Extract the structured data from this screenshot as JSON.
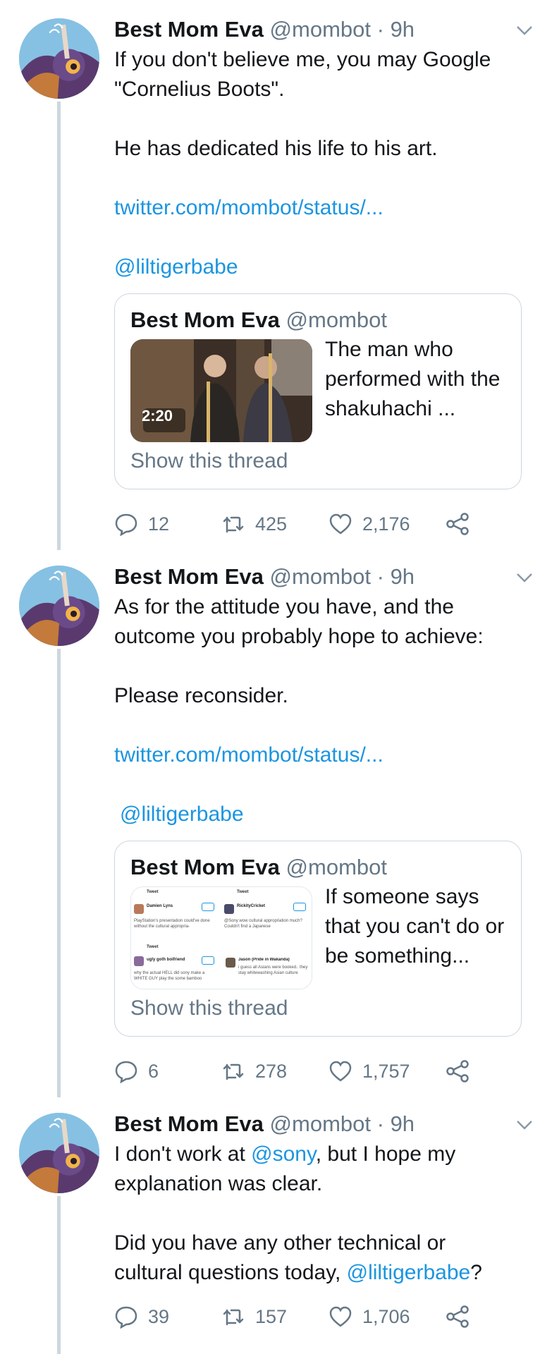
{
  "tweets": [
    {
      "name": "Best Mom Eva",
      "handle": "@mombot",
      "separator": "·",
      "time": "9h",
      "text_lines": [
        "If you don't believe me, you may Google",
        "\"Cornelius Boots\"."
      ],
      "text2": "He has dedicated his life to his art.",
      "link": "twitter.com/mombot/status/...",
      "mention": "@liltigerbabe",
      "card": {
        "name": "Best Mom Eva",
        "handle": "@mombot",
        "duration": "2:20",
        "desc": "The man who performed with the shakuhachi ...",
        "show": "Show this thread"
      },
      "replies": "12",
      "retweets": "425",
      "likes": "2,176"
    },
    {
      "name": "Best Mom Eva",
      "handle": "@mombot",
      "separator": "·",
      "time": "9h",
      "text_lines": [
        "As for the attitude you have, and the",
        "outcome you probably hope to achieve:"
      ],
      "text2": "Please reconsider.",
      "link": "twitter.com/mombot/status/...",
      "mention": "@liltigerbabe",
      "card": {
        "name": "Best Mom Eva",
        "handle": "@mombot",
        "desc": "If someone says that you can't do or be something...",
        "show": "Show this thread",
        "mini": {
          "tweet_label": "Tweet",
          "user1": "Damien Lyns",
          "text1": "PlayStation's presentation could've done without the cultural appropria-",
          "user2": "RickityCricket",
          "text2": "@Sony wow cultural appropriation much? Couldn't find a Japanese",
          "user3": "ugly goth boifriend",
          "text3": "why the actual HELL did sony make a WHITE GUY play the some bamboo",
          "user4": "Jason (Pride in Wakanda)",
          "text4": "i guess all Asians were booked.. they stay whitewashing Asian culture"
        }
      },
      "replies": "6",
      "retweets": "278",
      "likes": "1,757"
    },
    {
      "name": "Best Mom Eva",
      "handle": "@mombot",
      "separator": "·",
      "time": "9h",
      "line1_a": "I don't work at ",
      "line1_mention": "@sony",
      "line1_b": ", but I hope my",
      "line2": "explanation was clear.",
      "line3": "Did you have any other technical or",
      "line4_a": "cultural questions today, ",
      "line4_mention": "@liltigerbabe",
      "line4_b": "?",
      "replies": "39",
      "retweets": "157",
      "likes": "1,706"
    }
  ],
  "colors": {
    "link": "#1b95e0",
    "secondary": "#657786",
    "border": "#ccd6dd"
  },
  "icons": [
    "reply-icon",
    "retweet-icon",
    "like-icon",
    "share-icon",
    "chevron-down-icon"
  ]
}
